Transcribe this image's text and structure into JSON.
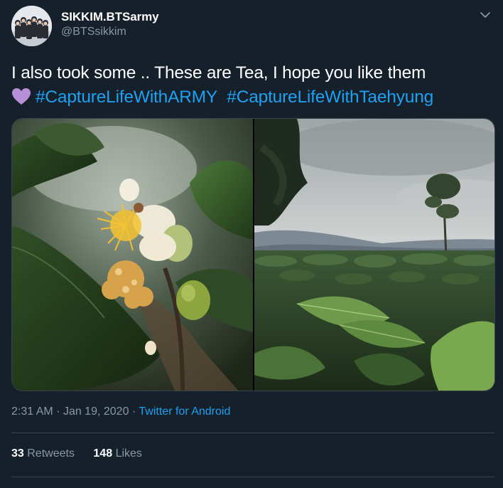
{
  "author": {
    "display_name": "SIKKIM.BTSarmy",
    "handle": "@BTSsikkim"
  },
  "tweet": {
    "text_prefix": "I also took some .. These are Tea, I hope you like them",
    "heart_emoji": "purple-heart",
    "hashtags": [
      "#CaptureLifeWithARMY",
      "#CaptureLifeWithTaehyung"
    ]
  },
  "media": [
    {
      "icon": "tea-flower-photo"
    },
    {
      "icon": "tea-plantation-photo"
    }
  ],
  "meta": {
    "time": "2:31 AM",
    "date": "Jan 19, 2020",
    "separator": "·",
    "source": "Twitter for Android"
  },
  "stats": {
    "retweets_count": "33",
    "retweets_label": "Retweets",
    "likes_count": "148",
    "likes_label": "Likes"
  },
  "colors": {
    "background": "#15202b",
    "accent": "#1da1f2",
    "secondary_text": "#8899a6",
    "divider": "#38444d",
    "heart": "#b68fd8"
  }
}
